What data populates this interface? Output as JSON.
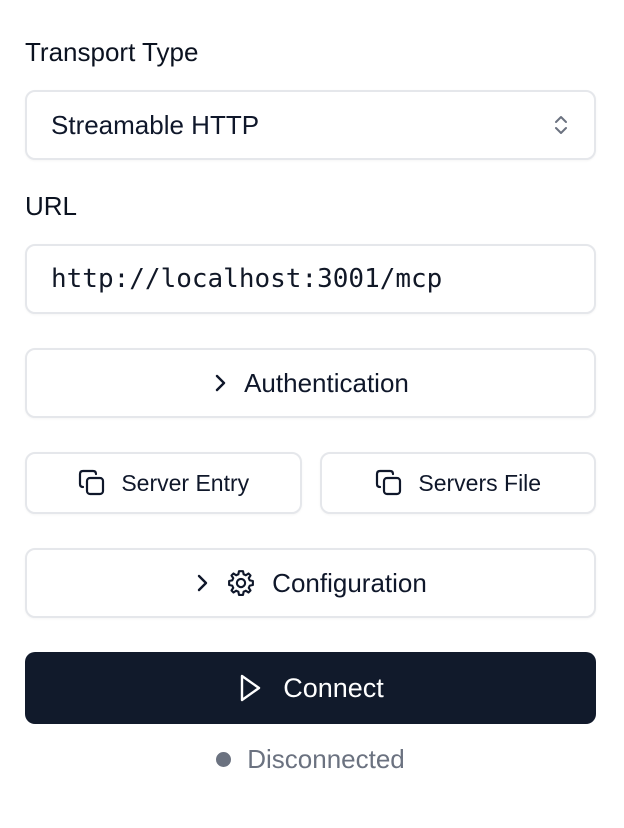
{
  "transport": {
    "label": "Transport Type",
    "selected": "Streamable HTTP"
  },
  "url": {
    "label": "URL",
    "value": "http://localhost:3001/mcp"
  },
  "authentication": {
    "label": "Authentication"
  },
  "copy_buttons": {
    "server_entry": "Server Entry",
    "servers_file": "Servers File"
  },
  "configuration": {
    "label": "Configuration"
  },
  "connect": {
    "label": "Connect"
  },
  "status": {
    "text": "Disconnected",
    "color": "#6b7280"
  },
  "icons": {
    "select": "chevrons-up-down-icon",
    "auth": "chevron-right-icon",
    "copy": "copy-icon",
    "config_chevron": "chevron-right-icon",
    "config": "gear-icon",
    "connect": "play-icon"
  },
  "colors": {
    "primary": "#111a2b",
    "border": "#e5e7eb"
  }
}
